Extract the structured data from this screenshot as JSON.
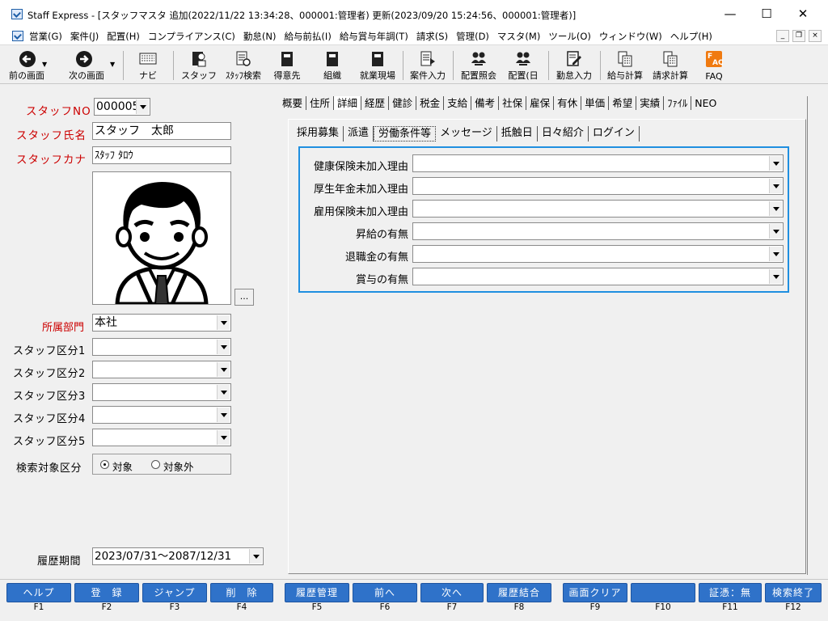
{
  "window": {
    "title": "Staff Express - [スタッフマスタ 追加(2022/11/22 13:34:28、000001:管理者) 更新(2023/09/20 15:24:56、000001:管理者)]",
    "minimize": "—",
    "maximize": "☐",
    "close": "✕"
  },
  "menu": [
    "営業(G)",
    "案件(J)",
    "配置(H)",
    "コンプライアンス(C)",
    "勤怠(N)",
    "給与前払(I)",
    "給与賞与年調(T)",
    "請求(S)",
    "管理(D)",
    "マスタ(M)",
    "ツール(O)",
    "ウィンドウ(W)",
    "ヘルプ(H)"
  ],
  "mdi": {
    "min": "_",
    "restore": "❐",
    "close": "×"
  },
  "toolbar": {
    "prev": "前の画面",
    "next": "次の画面",
    "navi": "ナビ",
    "staff": "スタッフ",
    "staff_search": "ｽﾀｯﾌ検索",
    "client": "得意先",
    "org": "組織",
    "worksite": "就業現場",
    "job_input": "案件入力",
    "assign_ref": "配置照会",
    "assign_day": "配置(日",
    "attendance": "勤怠入力",
    "payroll": "給与計算",
    "billing": "請求計算",
    "faq": "FAQ"
  },
  "left": {
    "staff_no_label": "スタッフNO",
    "staff_no": "000005",
    "staff_name_label": "スタッフ氏名",
    "staff_name": "スタッフ　太郎",
    "staff_kana_label": "スタッフカナ",
    "staff_kana": "ｽﾀｯﾌ ﾀﾛｳ",
    "photo_btn": "...",
    "dept_label": "所属部門",
    "dept": "本社",
    "div1": "スタッフ区分1",
    "div2": "スタッフ区分2",
    "div3": "スタッフ区分3",
    "div4": "スタッフ区分4",
    "div5": "スタッフ区分5",
    "search_label": "検索対象区分",
    "radio_on": "対象",
    "radio_off": "対象外",
    "period_label": "履歴期間",
    "period": "2023/07/31～2087/12/31"
  },
  "tabs_top": [
    "概要",
    "住所",
    "詳細",
    "経歴",
    "健診",
    "税金",
    "支給",
    "備考",
    "社保",
    "雇保",
    "有休",
    "単価",
    "希望",
    "実績",
    "ﾌｧｲﾙ",
    "NEO"
  ],
  "tabs_sub": [
    "採用募集",
    "派遣",
    "労働条件等",
    "メッセージ",
    "抵触日",
    "日々紹介",
    "ログイン"
  ],
  "form": {
    "r1": "健康保険未加入理由",
    "r2": "厚生年金未加入理由",
    "r3": "雇用保険未加入理由",
    "r4": "昇給の有無",
    "r5": "退職金の有無",
    "r6": "賞与の有無"
  },
  "fkeys": [
    {
      "label": "ヘルプ",
      "key": "F1"
    },
    {
      "label": "登　録",
      "key": "F2"
    },
    {
      "label": "ジャンプ",
      "key": "F3"
    },
    {
      "label": "削　除",
      "key": "F4"
    },
    {
      "label": "履歴管理",
      "key": "F5"
    },
    {
      "label": "前へ",
      "key": "F6"
    },
    {
      "label": "次へ",
      "key": "F7"
    },
    {
      "label": "履歴結合",
      "key": "F8"
    },
    {
      "label": "画面クリア",
      "key": "F9"
    },
    {
      "label": "",
      "key": "F10"
    },
    {
      "label": "証憑：無",
      "key": "F11"
    },
    {
      "label": "検索終了",
      "key": "F12"
    }
  ],
  "colors": {
    "accent": "#1f8fe0",
    "fkey": "#2f72c9",
    "required_label": "#cc0000"
  }
}
